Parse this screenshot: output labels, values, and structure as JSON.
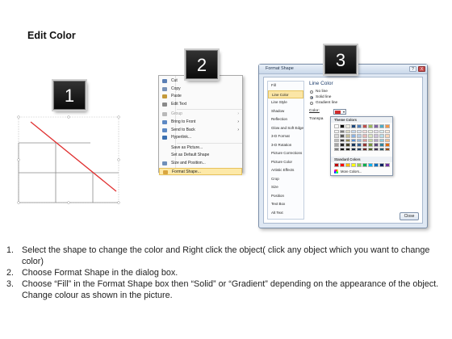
{
  "slide": {
    "title": "Edit Color"
  },
  "badges": [
    "1",
    "2",
    "3"
  ],
  "context_menu": {
    "items": [
      {
        "label": "Cut",
        "icon": "scissors-icon",
        "icon_color": "#5b7fb5",
        "disabled": false,
        "submenu": false
      },
      {
        "label": "Copy",
        "icon": "copy-icon",
        "icon_color": "#7a93b8",
        "disabled": false,
        "submenu": false
      },
      {
        "label": "Paste",
        "icon": "paste-icon",
        "icon_color": "#c49a3a",
        "disabled": false,
        "submenu": false
      },
      {
        "label": "Edit Text",
        "icon": "edit-text-icon",
        "icon_color": "#8a8a8a",
        "disabled": false,
        "submenu": false
      },
      {
        "separator": true
      },
      {
        "label": "Group",
        "icon": "group-icon",
        "icon_color": "#b9b9b9",
        "disabled": true,
        "submenu": true
      },
      {
        "label": "Bring to Front",
        "icon": "bring-front-icon",
        "icon_color": "#5d89c4",
        "disabled": false,
        "submenu": true
      },
      {
        "label": "Send to Back",
        "icon": "send-back-icon",
        "icon_color": "#5d89c4",
        "disabled": false,
        "submenu": true
      },
      {
        "label": "Hyperlink...",
        "icon": "hyperlink-icon",
        "icon_color": "#3a6fb0",
        "disabled": false,
        "submenu": false
      },
      {
        "separator": true
      },
      {
        "label": "Save as Picture...",
        "icon": "",
        "icon_color": "",
        "disabled": false,
        "submenu": false
      },
      {
        "label": "Set as Default Shape",
        "icon": "",
        "icon_color": "",
        "disabled": false,
        "submenu": false
      },
      {
        "label": "Size and Position...",
        "icon": "size-position-icon",
        "icon_color": "#6f8fb9",
        "disabled": false,
        "submenu": false
      },
      {
        "label": "Format Shape...",
        "icon": "format-shape-icon",
        "icon_color": "#d9a640",
        "disabled": false,
        "submenu": false,
        "highlight": true
      }
    ]
  },
  "dialog": {
    "title": "Format Shape",
    "window_buttons": [
      "?",
      "X"
    ],
    "nav": [
      "Fill",
      "Line Color",
      "Line Style",
      "Shadow",
      "Reflection",
      "Glow and Soft Edges",
      "3-D Format",
      "3-D Rotation",
      "Picture Corrections",
      "Picture Color",
      "Artistic Effects",
      "Crop",
      "Size",
      "Position",
      "Text Box",
      "Alt Text"
    ],
    "nav_selected": 1,
    "section_title": "Line Color",
    "options": [
      {
        "label": "No line",
        "selected": false
      },
      {
        "label": "Solid line",
        "selected": true
      },
      {
        "label": "Gradient line",
        "selected": false
      }
    ],
    "color_label": "Color:",
    "transparency_label": "Transpa",
    "close_label": "Close"
  },
  "color_popup": {
    "theme_header": "Theme Colors",
    "standard_header": "Standard Colors",
    "more_label": "More Colors...",
    "theme_top": [
      "#ffffff",
      "#000000",
      "#eeece1",
      "#1f497d",
      "#4f81bd",
      "#c0504d",
      "#9bbb59",
      "#8064a2",
      "#4bacc6",
      "#f79646"
    ],
    "theme_shades": [
      [
        "#f2f2f2",
        "#7f7f7f",
        "#ddd9c3",
        "#c6d9f0",
        "#dbe5f1",
        "#f2dcdb",
        "#ebf1dd",
        "#e5e0ec",
        "#dbeef3",
        "#fdeada"
      ],
      [
        "#d8d8d8",
        "#595959",
        "#c4bd97",
        "#8db3e2",
        "#b8cce4",
        "#e5b9b7",
        "#d7e3bc",
        "#ccc1d9",
        "#b7dde8",
        "#fbd5b5"
      ],
      [
        "#bfbfbf",
        "#3f3f3f",
        "#938953",
        "#548dd4",
        "#95b3d7",
        "#d99694",
        "#c3d69b",
        "#b2a2c7",
        "#92cddc",
        "#fac08f"
      ],
      [
        "#a5a5a5",
        "#262626",
        "#494429",
        "#17365d",
        "#366092",
        "#953734",
        "#76923c",
        "#5f497a",
        "#31859b",
        "#e36c09"
      ],
      [
        "#7f7f7f",
        "#0c0c0c",
        "#1d1b10",
        "#0f243e",
        "#244061",
        "#632423",
        "#4f6128",
        "#3f3151",
        "#205867",
        "#974806"
      ]
    ],
    "standard": [
      "#c00000",
      "#ff0000",
      "#ffc000",
      "#ffff00",
      "#92d050",
      "#00b050",
      "#00b0f0",
      "#0070c0",
      "#002060",
      "#7030a0"
    ]
  },
  "instructions": [
    {
      "num": "1.",
      "text": "Select the shape to change the color and Right click the object( click any object which you want to change color)"
    },
    {
      "num": "2.",
      "text": "Choose Format Shape in the dialog box."
    },
    {
      "num": "3.",
      "text": "Choose “Fill” in the Format Shape box then “Solid” or “Gradient” depending on the appearance of the object. Change colour as shown in the picture."
    }
  ],
  "colors": {
    "diagonal_line": "#e03030",
    "grid_line": "#8a8a8a",
    "highlight": "#fde9a8"
  }
}
